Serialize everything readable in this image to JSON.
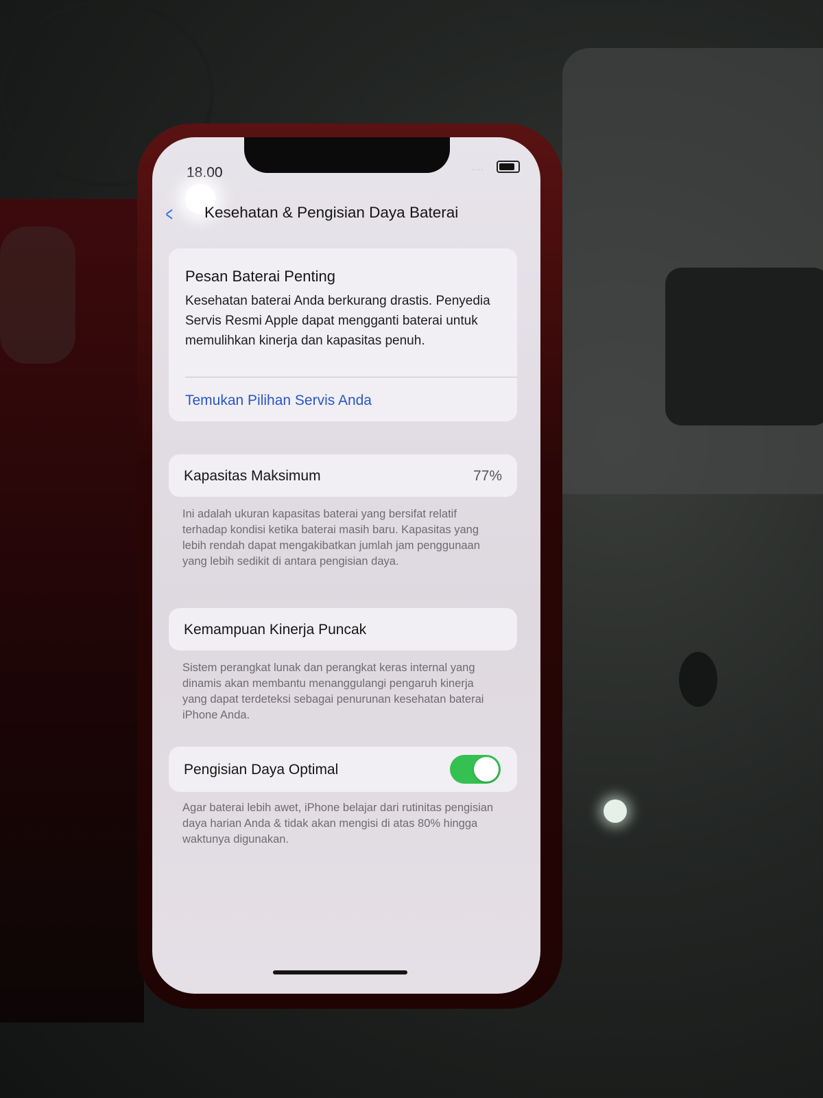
{
  "status_bar": {
    "time": "18.00"
  },
  "nav": {
    "title": "Kesehatan & Pengisian Daya Baterai"
  },
  "battery_message": {
    "title": "Pesan Baterai Penting",
    "body": "Kesehatan baterai Anda berkurang drastis. Penyedia Servis Resmi Apple dapat mengganti baterai untuk memulihkan kinerja dan kapasitas penuh.",
    "link": "Temukan Pilihan Servis Anda"
  },
  "max_capacity": {
    "label": "Kapasitas Maksimum",
    "value": "77%",
    "footnote": "Ini adalah ukuran kapasitas baterai yang bersifat relatif terhadap kondisi ketika baterai masih baru. Kapasitas yang lebih rendah dapat mengakibatkan jumlah jam penggunaan yang lebih sedikit di antara pengisian daya."
  },
  "peak_performance": {
    "label": "Kemampuan Kinerja Puncak",
    "footnote": "Sistem perangkat lunak dan perangkat keras internal yang dinamis akan membantu menanggulangi pengaruh kinerja yang dapat terdeteksi sebagai penurunan kesehatan baterai iPhone Anda."
  },
  "optimized_charging": {
    "label": "Pengisian Daya Optimal",
    "enabled": true,
    "footnote": "Agar baterai lebih awet, iPhone belajar dari rutinitas pengisian daya harian Anda & tidak akan mengisi di atas 80% hingga waktunya digunakan."
  },
  "colors": {
    "accent": "#2a55c4",
    "toggle_on": "#35c052"
  }
}
